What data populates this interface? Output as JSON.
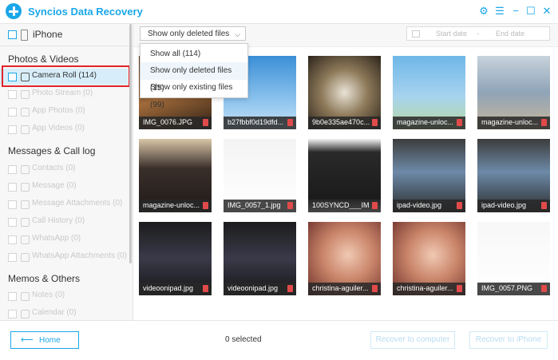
{
  "app": {
    "title": "Syncios Data Recovery"
  },
  "sidebar": {
    "device": "iPhone",
    "groups": [
      {
        "title": "Photos & Videos",
        "items": [
          {
            "label": "Camera Roll (114)",
            "active": true
          },
          {
            "label": "Photo Stream (0)"
          },
          {
            "label": "App Photos (0)"
          },
          {
            "label": "App Videos (0)"
          }
        ]
      },
      {
        "title": "Messages & Call log",
        "items": [
          {
            "label": "Contacts (0)"
          },
          {
            "label": "Message (0)"
          },
          {
            "label": "Message Attachments (0)"
          },
          {
            "label": "Call History (0)"
          },
          {
            "label": "WhatsApp (0)"
          },
          {
            "label": "WhatsApp Attachments (0)"
          }
        ]
      },
      {
        "title": "Memos & Others",
        "items": [
          {
            "label": "Notes (0)"
          },
          {
            "label": "Calendar (0)"
          }
        ]
      }
    ]
  },
  "filter": {
    "selected": "Show only deleted files (15)",
    "options": [
      "Show all (114)",
      "Show only deleted files (15)",
      "Show only existing files (99)"
    ]
  },
  "dates": {
    "start": "Start date",
    "separator": "-",
    "end": "End date"
  },
  "photos": [
    {
      "name": "IMG_0076.JPG",
      "bg": "linear-gradient(160deg,#5a3b22 0%,#a06a3a 50%,#2d1f14 100%)"
    },
    {
      "name": "b27fbbf0d19dfd...",
      "bg": "linear-gradient(180deg,#3b8fd6 0%,#8cc3ee 60%,#c7e2f6 100%)"
    },
    {
      "name": "9b0e335ae470c...",
      "bg": "radial-gradient(circle at 50% 50%,#e9e3d6 0%,#8e7a5a 45%,#2c241b 100%)"
    },
    {
      "name": "magazine-unloc...",
      "bg": "linear-gradient(180deg,#6fb7e8 0%,#a6d3ef 55%,#b8d9a0 100%)"
    },
    {
      "name": "magazine-unloc...",
      "bg": "linear-gradient(180deg,#c8d3dc 0%,#8fa4b8 50%,#c9b69c 100%)"
    },
    {
      "name": "magazine-unloc...",
      "bg": "linear-gradient(180deg,#d9c6a8 0%,#3a2f2a 40%,#1e1a18 100%)"
    },
    {
      "name": "IMG_0057_1.jpg",
      "bg": "linear-gradient(180deg,#f4f4f4 0%,#ffffff 100%)"
    },
    {
      "name": "100SYNCD___IM...",
      "bg": "linear-gradient(180deg,#f2f2f2 0%,#2a2a2a 18%,#1b1b1b 82%,#f2f2f2 100%)"
    },
    {
      "name": "ipad-video.jpg",
      "bg": "linear-gradient(180deg,#3c3c3c 0%,#6d8aa8 45%,#2b2b2b 100%)"
    },
    {
      "name": "ipad-video.jpg",
      "bg": "linear-gradient(180deg,#3c3c3c 0%,#6d8aa8 45%,#2b2b2b 100%)"
    },
    {
      "name": "videoonipad.jpg",
      "bg": "linear-gradient(180deg,#1c1c1c 0%,#3a3a4a 50%,#151515 100%)"
    },
    {
      "name": "videoonipad.jpg",
      "bg": "linear-gradient(180deg,#1c1c1c 0%,#3a3a4a 50%,#151515 100%)"
    },
    {
      "name": "christina-aguiler...",
      "bg": "radial-gradient(circle at 55% 45%,#f1c9b3 0%,#c98469 45%,#6b2f2a 100%)"
    },
    {
      "name": "christina-aguiler...",
      "bg": "radial-gradient(circle at 55% 45%,#f1c9b3 0%,#c98469 45%,#6b2f2a 100%)"
    },
    {
      "name": "IMG_0057.PNG",
      "bg": "linear-gradient(180deg,#f7f7f7 0%,#ffffff 100%)"
    }
  ],
  "footer": {
    "home": "Home",
    "selected": "0 selected",
    "recover_computer": "Recover to computer",
    "recover_iphone": "Recover to iPhone"
  },
  "colors": {
    "accent": "#1aa7e8",
    "highlight": "#e0242b",
    "trash": "#e04a4a"
  }
}
